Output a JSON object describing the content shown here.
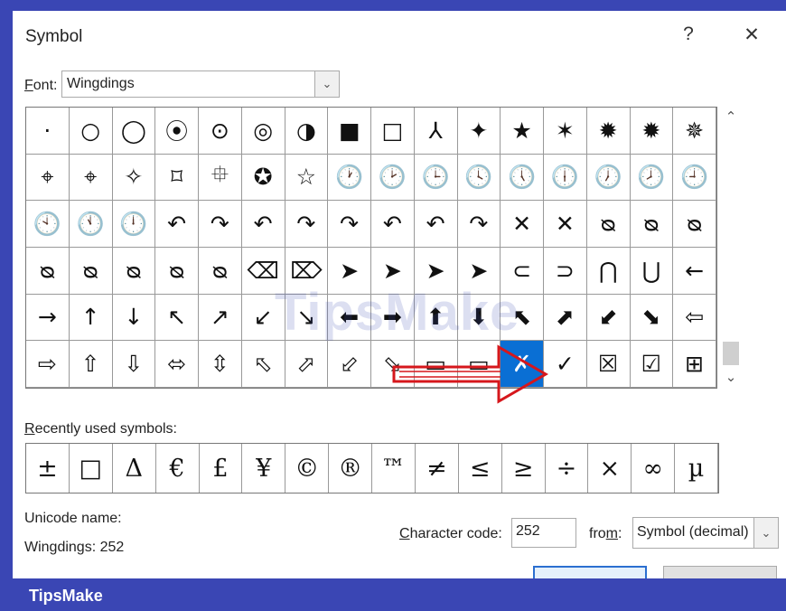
{
  "dialog": {
    "title": "Symbol",
    "help_label": "?",
    "close_label": "✕"
  },
  "font": {
    "label_key": "F",
    "label_rest": "ont:",
    "value": "Wingdings",
    "dropdown_icon": "chevron-down-icon"
  },
  "symbol_grid": {
    "selected_index": 91,
    "rows": [
      [
        "·",
        "○",
        "◯",
        "⦿",
        "⊙",
        "◎",
        "◑",
        "■",
        "□",
        "⅄",
        "✦",
        "★",
        "✶",
        "✹",
        "✹",
        "✵"
      ],
      [
        "⌖",
        "⌖",
        "✧",
        "⌑",
        "⯐",
        "✪",
        "☆",
        "🕐",
        "🕑",
        "🕒",
        "🕓",
        "🕔",
        "🕕",
        "🕖",
        "🕗",
        "🕘"
      ],
      [
        "🕙",
        "🕚",
        "🕛",
        "↶",
        "↷",
        "↶",
        "↷",
        "↷",
        "↶",
        "↶",
        "↷",
        "✕",
        "✕",
        "ᴓ",
        "ᴓ",
        "ᴓ"
      ],
      [
        "ᴓ",
        "ᴓ",
        "ᴓ",
        "ᴓ",
        "ᴓ",
        "⌫",
        "⌦",
        "➤",
        "➤",
        "➤",
        "➤",
        "⊂",
        "⊃",
        "⋂",
        "⋃",
        "←"
      ],
      [
        "→",
        "↑",
        "↓",
        "↖",
        "↗",
        "↙",
        "↘",
        "⬅",
        "➡",
        "⬆",
        "⬇",
        "⬉",
        "⬈",
        "⬋",
        "⬊",
        "⇦"
      ],
      [
        "⇨",
        "⇧",
        "⇩",
        "⬄",
        "⇳",
        "⬁",
        "⬀",
        "⬃",
        "⬂",
        "▭",
        "▭",
        "✗",
        "✓",
        "☒",
        "☑",
        "⊞"
      ]
    ]
  },
  "recent": {
    "label": "Recently used symbols:",
    "label_key": "R",
    "symbols": [
      "±",
      "□",
      "Δ",
      "€",
      "£",
      "¥",
      "©",
      "®",
      "™",
      "≠",
      "≤",
      "≥",
      "÷",
      "×",
      "∞",
      "µ"
    ]
  },
  "unicode": {
    "name_label": "Unicode name:",
    "name_value": "Wingdings: 252"
  },
  "charcode": {
    "label_key": "C",
    "label_rest": "haracter code:",
    "value": "252"
  },
  "from": {
    "label_pre": "fro",
    "label_key": "m",
    "label_post": ":",
    "value": "Symbol (decimal)",
    "dropdown_icon": "chevron-down-icon"
  },
  "watermark": {
    "banner": "TipsMake",
    "overlay": "TipsMake"
  },
  "colors": {
    "frame_blue": "#3a46b4",
    "selected": "#0a6fd4",
    "arrow_red": "#d6171c"
  }
}
